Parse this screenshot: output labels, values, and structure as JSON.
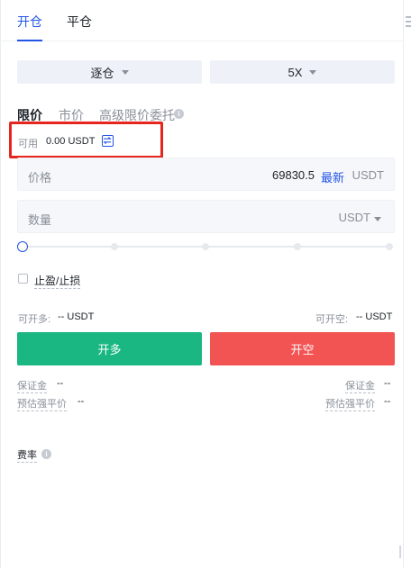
{
  "top_tabs": {
    "open": "开仓",
    "close": "平仓"
  },
  "selectors": {
    "margin_mode": "逐仓",
    "leverage": "5X"
  },
  "order_tabs": {
    "limit": "限价",
    "market": "市价",
    "advanced": "高级限价委托"
  },
  "available": {
    "label": "可用",
    "value": "0.00 USDT"
  },
  "price_input": {
    "label": "价格",
    "value": "69830.5",
    "latest": "最新",
    "unit": "USDT"
  },
  "quantity_input": {
    "placeholder": "数量",
    "unit": "USDT"
  },
  "slider": {
    "value_percent": 0,
    "stops": 5
  },
  "tpsl": {
    "label": "止盈/止损",
    "checked": false
  },
  "capacity": {
    "long_label": "可开多:",
    "long_value": "-- USDT",
    "short_label": "可开空:",
    "short_value": "-- USDT"
  },
  "buttons": {
    "long": "开多",
    "short": "开空"
  },
  "details": {
    "margin_label": "保证金",
    "margin_value_left": "--",
    "margin_value_right": "--",
    "liq_label": "预估强平价",
    "liq_value_left": "--",
    "liq_value_right": "--"
  },
  "fee": {
    "label": "费率"
  },
  "colors": {
    "accent": "#2354e6",
    "long": "#1bb783",
    "short": "#f25353",
    "highlight": "#e5261f"
  }
}
